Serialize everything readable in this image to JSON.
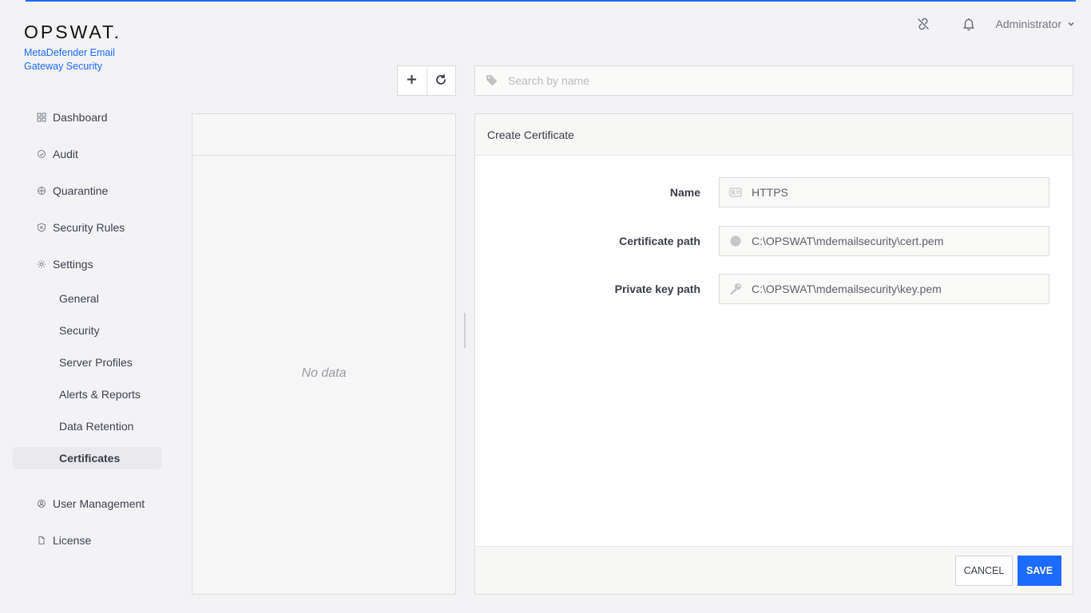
{
  "brand": {
    "logo": "OPSWAT.",
    "product": "MetaDefender Email Gateway Security"
  },
  "topbar": {
    "icons": [
      "unlink-icon",
      "bell-icon"
    ],
    "user": "Administrator"
  },
  "sidebar": {
    "items": [
      {
        "label": "Dashboard",
        "icon": "dashboard-icon"
      },
      {
        "label": "Audit",
        "icon": "audit-icon"
      },
      {
        "label": "Quarantine",
        "icon": "quarantine-icon"
      },
      {
        "label": "Security Rules",
        "icon": "shield-icon"
      },
      {
        "label": "Settings",
        "icon": "gear-icon"
      }
    ],
    "settings_sub": [
      "General",
      "Security",
      "Server Profiles",
      "Alerts & Reports",
      "Data Retention",
      "Certificates"
    ],
    "active_sub": "Certificates",
    "bottom_items": [
      {
        "label": "User Management",
        "icon": "user-management-icon"
      },
      {
        "label": "License",
        "icon": "license-icon"
      }
    ]
  },
  "toolbar": {
    "add_icon": "plus-icon",
    "refresh_icon": "refresh-icon"
  },
  "search": {
    "placeholder": "Search by name",
    "value": ""
  },
  "list": {
    "empty_text": "No data"
  },
  "form": {
    "title": "Create Certificate",
    "fields": [
      {
        "label": "Name",
        "value": "HTTPS",
        "icon": "id-card-icon"
      },
      {
        "label": "Certificate path",
        "value": "C:\\OPSWAT\\mdemailsecurity\\cert.pem",
        "icon": "certificate-icon"
      },
      {
        "label": "Private key path",
        "value": "C:\\OPSWAT\\mdemailsecurity\\key.pem",
        "icon": "key-icon"
      }
    ],
    "cancel_label": "CANCEL",
    "save_label": "SAVE"
  },
  "colors": {
    "accent": "#1d6bfc",
    "background": "#f3f3f5"
  }
}
